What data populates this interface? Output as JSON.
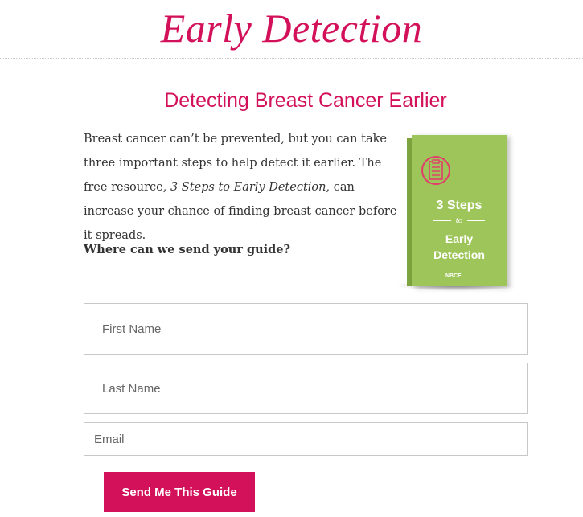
{
  "header": {
    "site_title": "Early Detection"
  },
  "main": {
    "heading": "Detecting Breast Cancer Earlier",
    "intro_before": "Breast cancer can’t be prevented, but you can take three important steps to help detect it earlier. The free resource, ",
    "intro_emphasis": "3 Steps to Early Detection",
    "intro_after": ", can increase your chance of finding breast cancer before it spreads.",
    "prompt": "Where can we send your guide?"
  },
  "book": {
    "title_line1": "3 Steps",
    "title_line2": "to",
    "title_line3": "Early",
    "title_line4": "Detection",
    "logo": "NBCF",
    "cover_color": "#9ec55a",
    "icon": "checklist-icon"
  },
  "form": {
    "first_name_placeholder": "First Name",
    "last_name_placeholder": "Last Name",
    "email_placeholder": "Email",
    "submit_label": "Send Me This Guide"
  },
  "colors": {
    "accent": "#d3115a",
    "text": "#333333",
    "border": "#c8c8c8"
  }
}
